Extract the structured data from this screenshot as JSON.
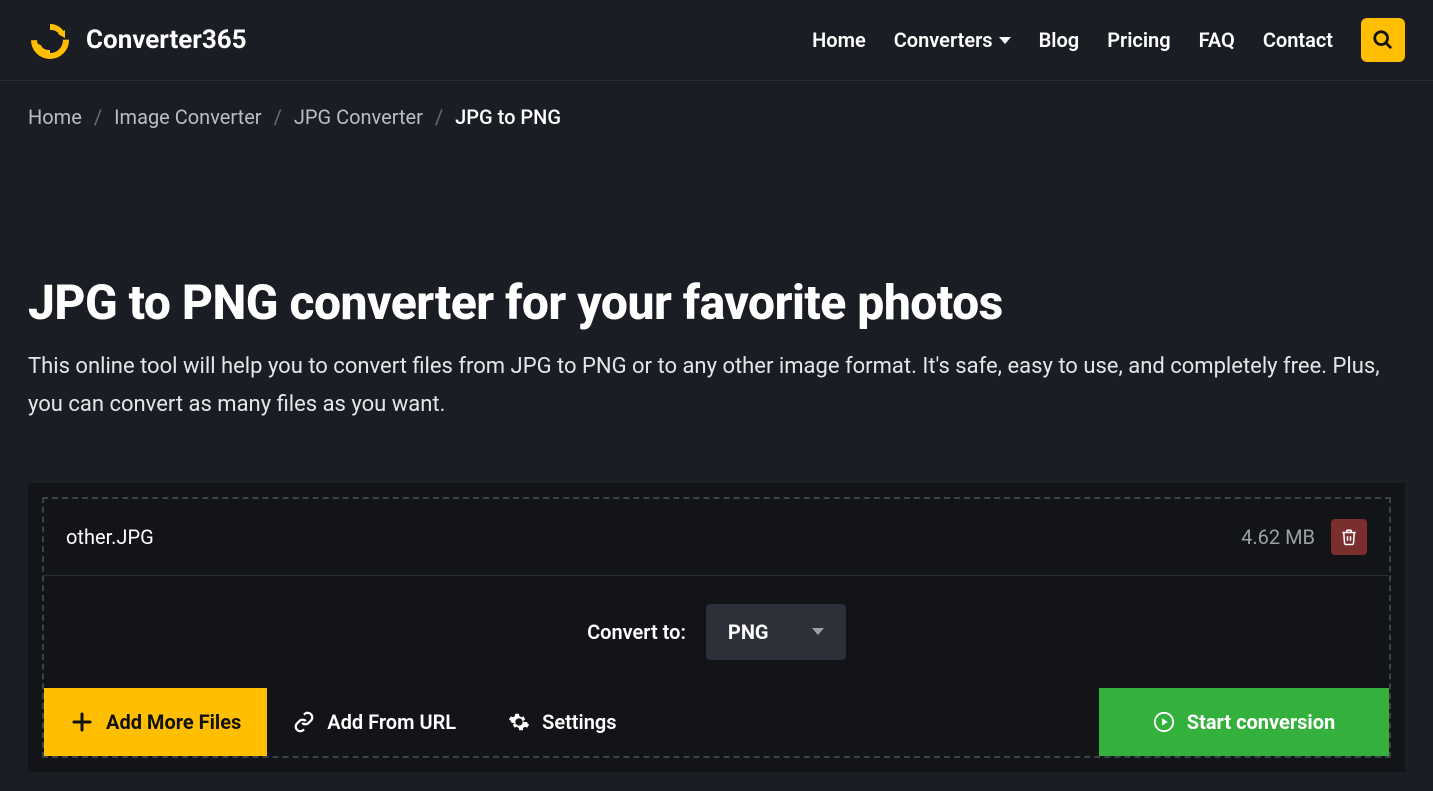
{
  "header": {
    "logo_text": "Converter365",
    "nav": {
      "home": "Home",
      "converters": "Converters",
      "blog": "Blog",
      "pricing": "Pricing",
      "faq": "FAQ",
      "contact": "Contact"
    }
  },
  "breadcrumbs": {
    "items": [
      "Home",
      "Image Converter",
      "JPG Converter"
    ],
    "current": "JPG to PNG"
  },
  "page": {
    "title": "JPG to PNG converter for your favorite photos",
    "subtitle": "This online tool will help you to convert files from JPG to PNG or to any other image format. It's safe, easy to use, and completely free. Plus, you can convert as many files as you want."
  },
  "file": {
    "name": "other.JPG",
    "size": "4.62 MB"
  },
  "convert": {
    "label": "Convert to:",
    "selected": "PNG"
  },
  "actions": {
    "add_more": "Add More Files",
    "add_url": "Add From URL",
    "settings": "Settings",
    "start": "Start conversion"
  }
}
